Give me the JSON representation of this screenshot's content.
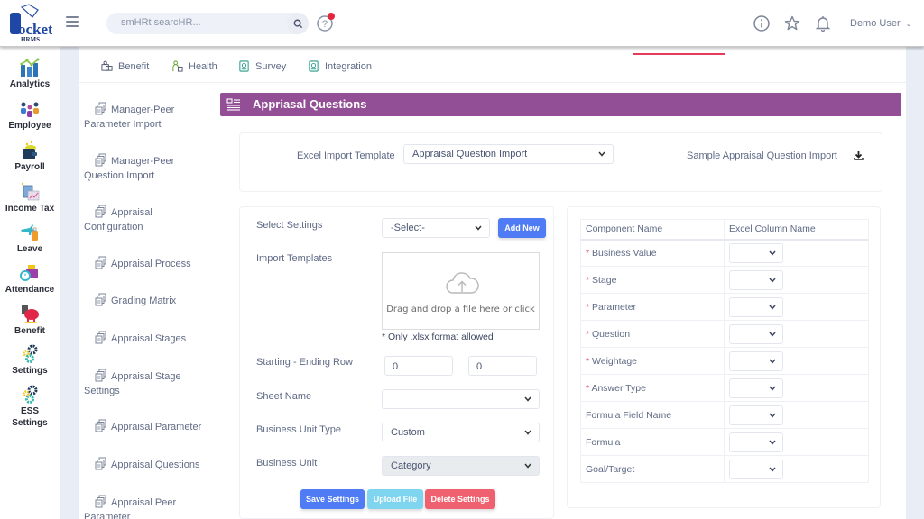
{
  "header": {
    "logo_text": "Pocket",
    "logo_sub": "HRMS",
    "search_placeholder": "smHRt searcHR...",
    "user_name": "Demo User",
    "colors": {
      "notification_dot": "#e3263d",
      "accent_underline": "#e8395b"
    }
  },
  "rail": {
    "items": [
      {
        "label": "Analytics",
        "icon": "analytics-icon"
      },
      {
        "label": "Employee",
        "icon": "employee-icon"
      },
      {
        "label": "Payroll",
        "icon": "payroll-icon"
      },
      {
        "label": "Income Tax",
        "icon": "income-tax-icon"
      },
      {
        "label": "Leave",
        "icon": "leave-icon"
      },
      {
        "label": "Attendance",
        "icon": "attendance-icon"
      },
      {
        "label": "Benefit",
        "icon": "benefit-icon"
      },
      {
        "label": "Settings",
        "icon": "settings-icon"
      },
      {
        "label": "ESS",
        "label2": "Settings",
        "icon": "ess-settings-icon"
      }
    ]
  },
  "tabs": [
    {
      "label": "Benefit",
      "icon": "benefit-tab-icon"
    },
    {
      "label": "Health",
      "icon": "health-tab-icon"
    },
    {
      "label": "Survey",
      "icon": "survey-tab-icon"
    },
    {
      "label": "Integration",
      "icon": "integration-tab-icon"
    }
  ],
  "subnav": [
    {
      "line1": "Manager-Peer",
      "line2": "Parameter Import"
    },
    {
      "line1": "Manager-Peer",
      "line2": "Question Import"
    },
    {
      "line1": "Appraisal",
      "line2": "Configuration"
    },
    {
      "line1": "Appraisal Process",
      "line2": ""
    },
    {
      "line1": "Grading Matrix",
      "line2": ""
    },
    {
      "line1": "Appraisal Stages",
      "line2": ""
    },
    {
      "line1": "Appraisal Stage",
      "line2": "Settings"
    },
    {
      "line1": "Appraisal Parameter",
      "line2": ""
    },
    {
      "line1": "Appraisal Questions",
      "line2": ""
    },
    {
      "line1": "Appraisal Peer",
      "line2": "Parameter"
    }
  ],
  "panel": {
    "title": "Appriasal Questions",
    "header_color": "#924f96",
    "template_label": "Excel Import Template",
    "template_value": "Appraisal Question Import",
    "sample_link": "Sample Appraisal Question Import"
  },
  "form": {
    "select_settings_label": "Select Settings",
    "select_settings_value": "-Select-",
    "add_new_label": "Add New",
    "import_templates_label": "Import Templates",
    "dropzone_text": "Drag and drop a file here or click",
    "format_note": "* Only .xlsx format allowed",
    "row_label": "Starting - Ending Row",
    "start_row": "0",
    "end_row": "0",
    "sheet_name_label": "Sheet Name",
    "sheet_name_value": "",
    "bu_type_label": "Business Unit Type",
    "bu_type_value": "Custom",
    "bu_label": "Business Unit",
    "bu_value": "Category",
    "save_label": "Save Settings",
    "upload_label": "Upload File",
    "delete_label": "Delete Settings",
    "colors": {
      "save": "#4f7cf5",
      "upload": "#7fd5ef",
      "delete": "#f0616f",
      "add_new": "#4f7cf5"
    }
  },
  "mapping": {
    "col_component": "Component Name",
    "col_excel": "Excel Column Name",
    "rows": [
      {
        "name": "Business Value",
        "required": true,
        "value": ""
      },
      {
        "name": "Stage",
        "required": true,
        "value": ""
      },
      {
        "name": "Parameter",
        "required": true,
        "value": ""
      },
      {
        "name": "Question",
        "required": true,
        "value": ""
      },
      {
        "name": "Weightage",
        "required": true,
        "value": ""
      },
      {
        "name": "Answer Type",
        "required": true,
        "value": ""
      },
      {
        "name": "Formula Field Name",
        "required": false,
        "value": ""
      },
      {
        "name": "Formula",
        "required": false,
        "value": ""
      },
      {
        "name": "Goal/Target",
        "required": false,
        "value": ""
      }
    ]
  }
}
